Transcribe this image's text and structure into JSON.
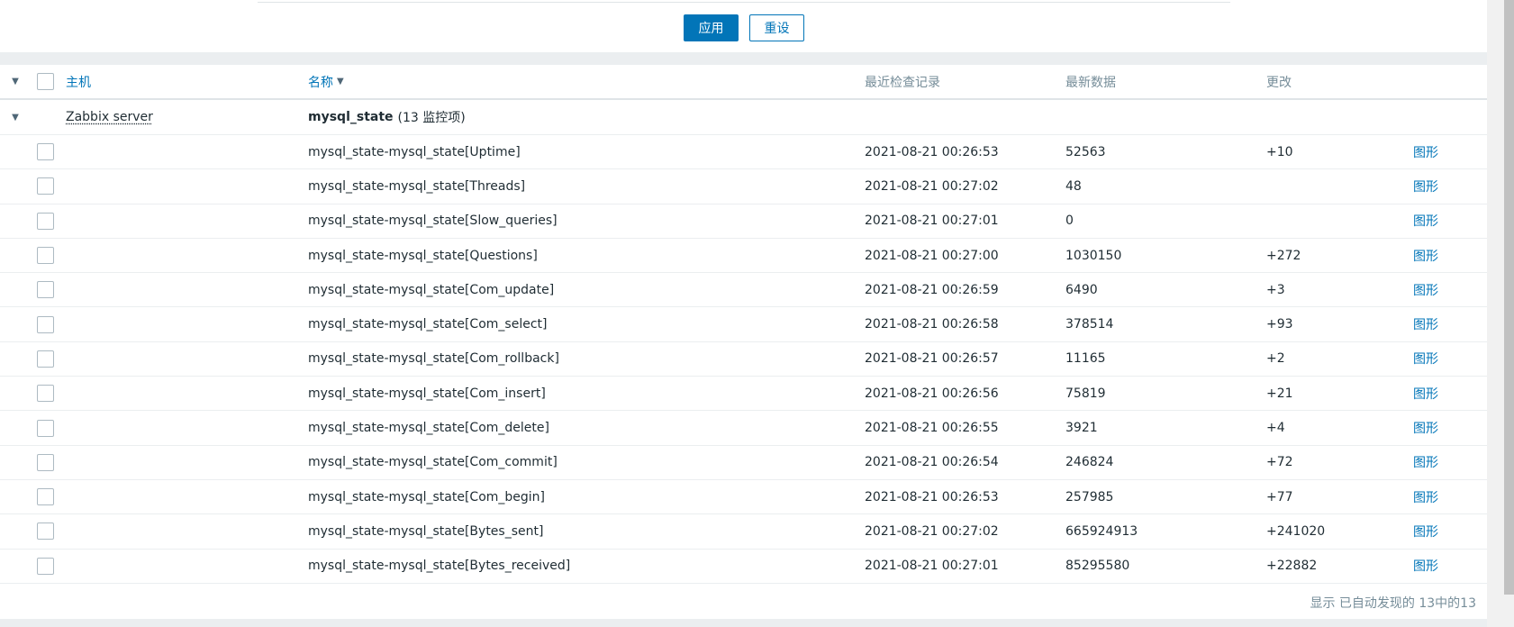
{
  "filter": {
    "apply_label": "应用",
    "reset_label": "重设"
  },
  "table": {
    "headers": {
      "host": "主机",
      "name": "名称",
      "last_check": "最近检查记录",
      "last_value": "最新数据",
      "change": "更改"
    },
    "group": {
      "host": "Zabbix server",
      "app_name": "mysql_state",
      "count_text": "(13 监控项)"
    },
    "rows": [
      {
        "name": "mysql_state-mysql_state[Uptime]",
        "last_check": "2021-08-21 00:26:53",
        "last_value": "52563",
        "change": "+10",
        "graph": "图形"
      },
      {
        "name": "mysql_state-mysql_state[Threads]",
        "last_check": "2021-08-21 00:27:02",
        "last_value": "48",
        "change": "",
        "graph": "图形"
      },
      {
        "name": "mysql_state-mysql_state[Slow_queries]",
        "last_check": "2021-08-21 00:27:01",
        "last_value": "0",
        "change": "",
        "graph": "图形"
      },
      {
        "name": "mysql_state-mysql_state[Questions]",
        "last_check": "2021-08-21 00:27:00",
        "last_value": "1030150",
        "change": "+272",
        "graph": "图形"
      },
      {
        "name": "mysql_state-mysql_state[Com_update]",
        "last_check": "2021-08-21 00:26:59",
        "last_value": "6490",
        "change": "+3",
        "graph": "图形"
      },
      {
        "name": "mysql_state-mysql_state[Com_select]",
        "last_check": "2021-08-21 00:26:58",
        "last_value": "378514",
        "change": "+93",
        "graph": "图形"
      },
      {
        "name": "mysql_state-mysql_state[Com_rollback]",
        "last_check": "2021-08-21 00:26:57",
        "last_value": "11165",
        "change": "+2",
        "graph": "图形"
      },
      {
        "name": "mysql_state-mysql_state[Com_insert]",
        "last_check": "2021-08-21 00:26:56",
        "last_value": "75819",
        "change": "+21",
        "graph": "图形"
      },
      {
        "name": "mysql_state-mysql_state[Com_delete]",
        "last_check": "2021-08-21 00:26:55",
        "last_value": "3921",
        "change": "+4",
        "graph": "图形"
      },
      {
        "name": "mysql_state-mysql_state[Com_commit]",
        "last_check": "2021-08-21 00:26:54",
        "last_value": "246824",
        "change": "+72",
        "graph": "图形"
      },
      {
        "name": "mysql_state-mysql_state[Com_begin]",
        "last_check": "2021-08-21 00:26:53",
        "last_value": "257985",
        "change": "+77",
        "graph": "图形"
      },
      {
        "name": "mysql_state-mysql_state[Bytes_sent]",
        "last_check": "2021-08-21 00:27:02",
        "last_value": "665924913",
        "change": "+241020",
        "graph": "图形"
      },
      {
        "name": "mysql_state-mysql_state[Bytes_received]",
        "last_check": "2021-08-21 00:27:01",
        "last_value": "85295580",
        "change": "+22882",
        "graph": "图形"
      }
    ],
    "footer": "显示 已自动发现的 13中的13"
  },
  "icons": {
    "collapse": "triangle-down-icon",
    "sort": "sort-desc-icon"
  },
  "colors": {
    "accent": "#0275b8",
    "muted": "#768d99",
    "background": "#ebeef0"
  }
}
